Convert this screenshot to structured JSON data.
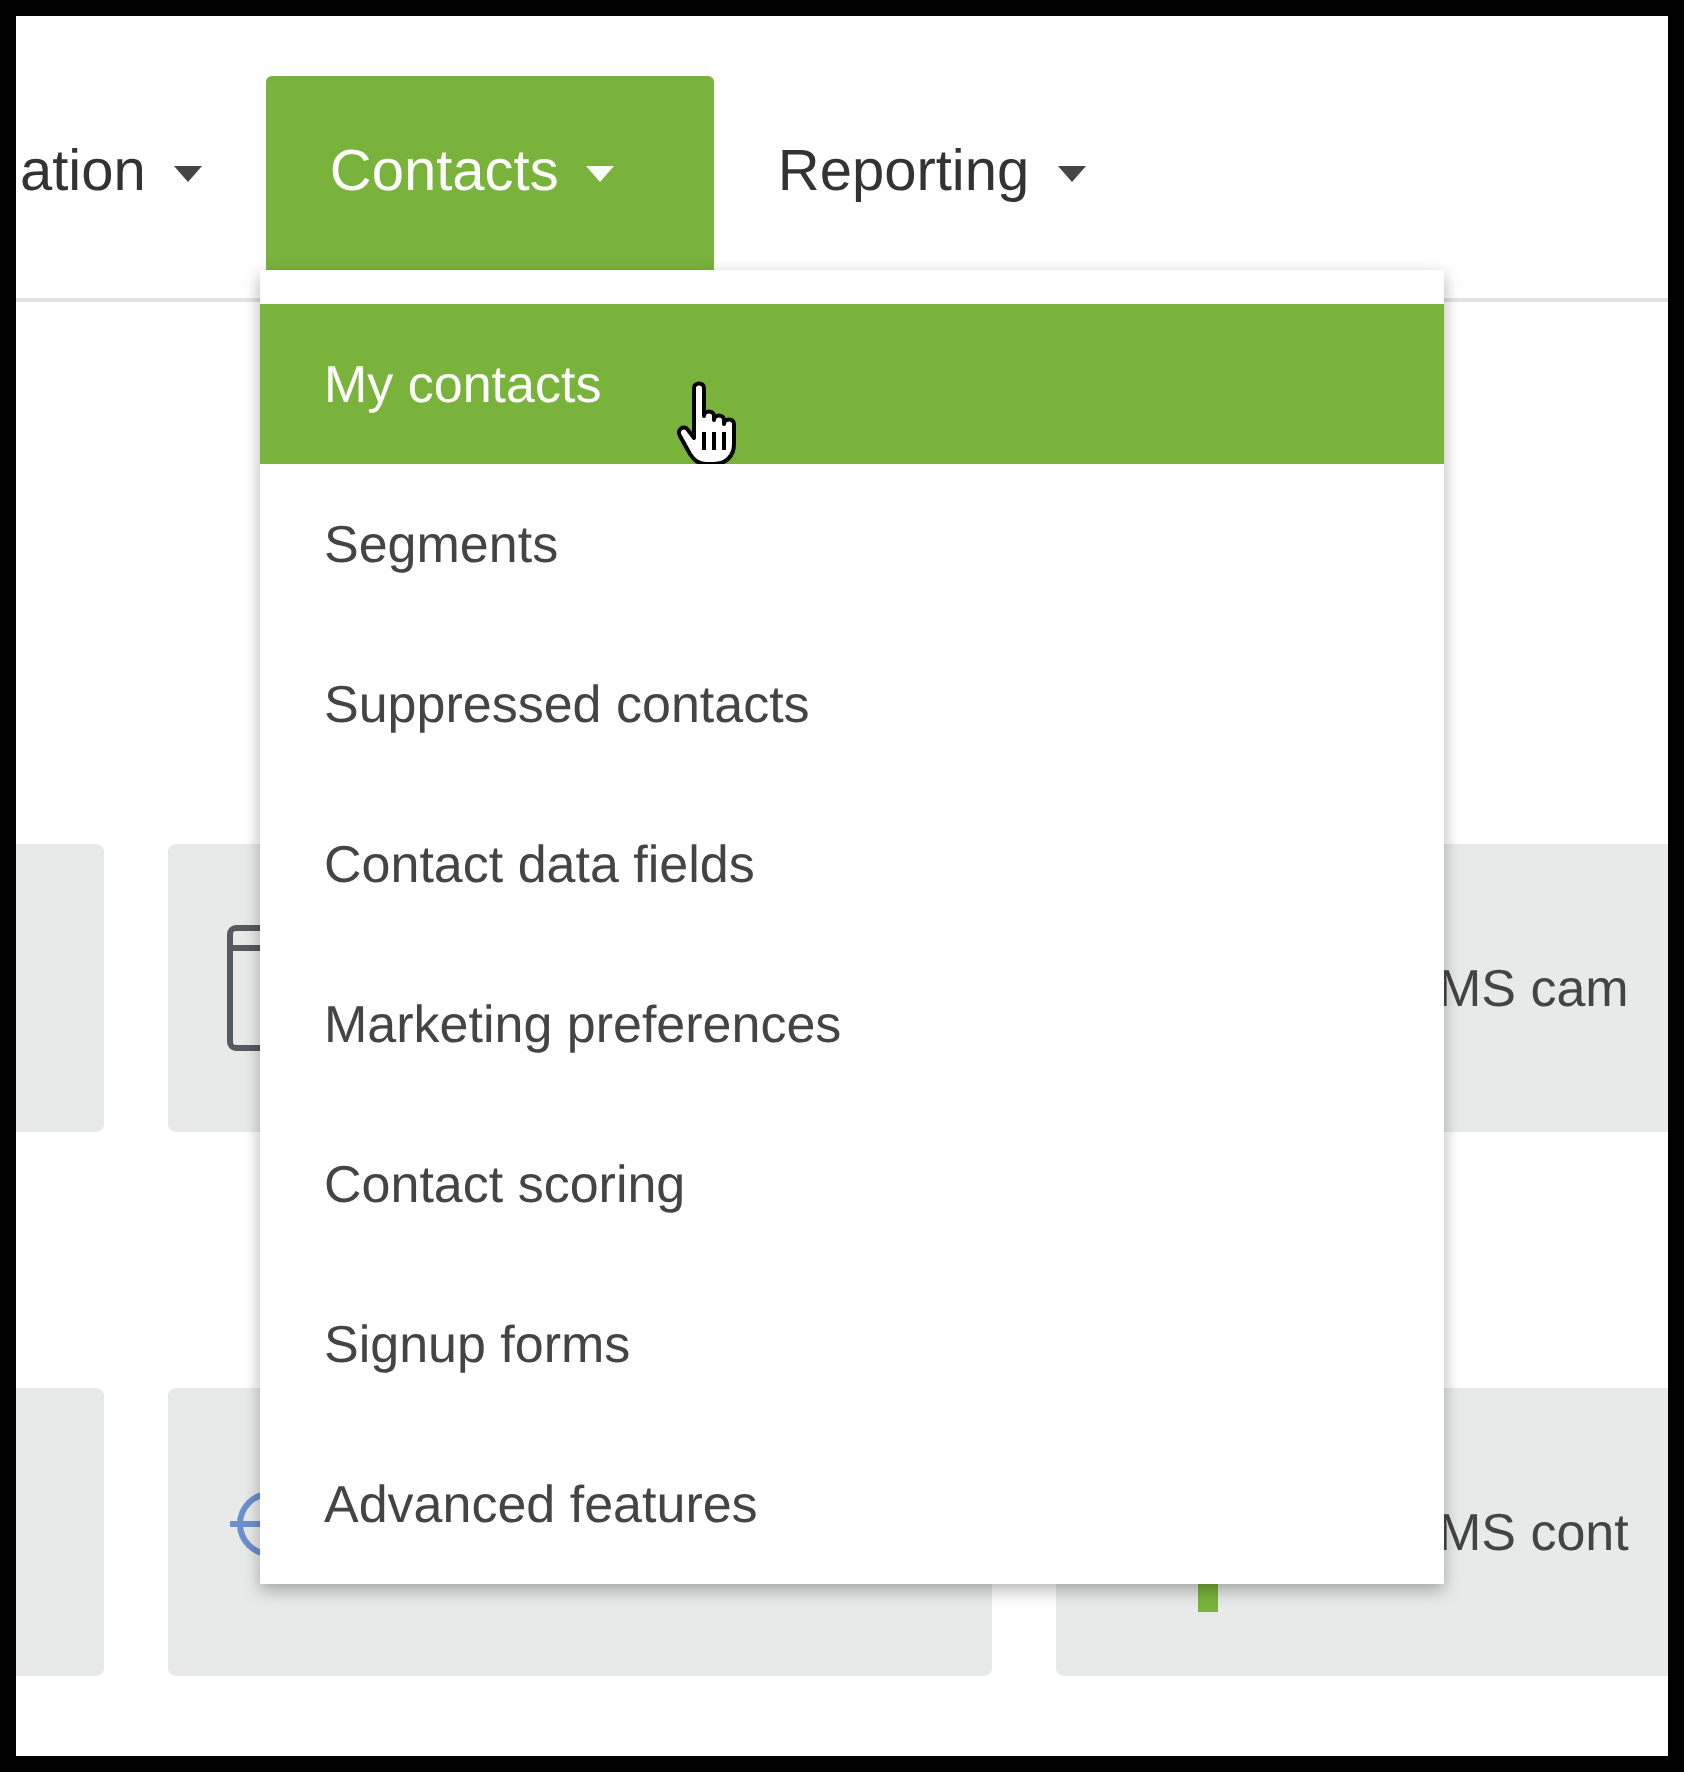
{
  "nav": [
    {
      "label": "ation",
      "selected": false
    },
    {
      "label": "Contacts",
      "selected": true
    },
    {
      "label": "Reporting",
      "selected": false
    }
  ],
  "dropdown": {
    "items": [
      {
        "label": "My contacts",
        "selected": true
      },
      {
        "label": "Segments",
        "selected": false
      },
      {
        "label": "Suppressed contacts",
        "selected": false
      },
      {
        "label": "Contact data fields",
        "selected": false
      },
      {
        "label": "Marketing preferences",
        "selected": false
      },
      {
        "label": "Contact scoring",
        "selected": false
      },
      {
        "label": "Signup forms",
        "selected": false
      },
      {
        "label": "Advanced features",
        "selected": false
      }
    ]
  },
  "cards": [
    {
      "label": "MS cam"
    },
    {
      "label": "MS cont"
    }
  ]
}
